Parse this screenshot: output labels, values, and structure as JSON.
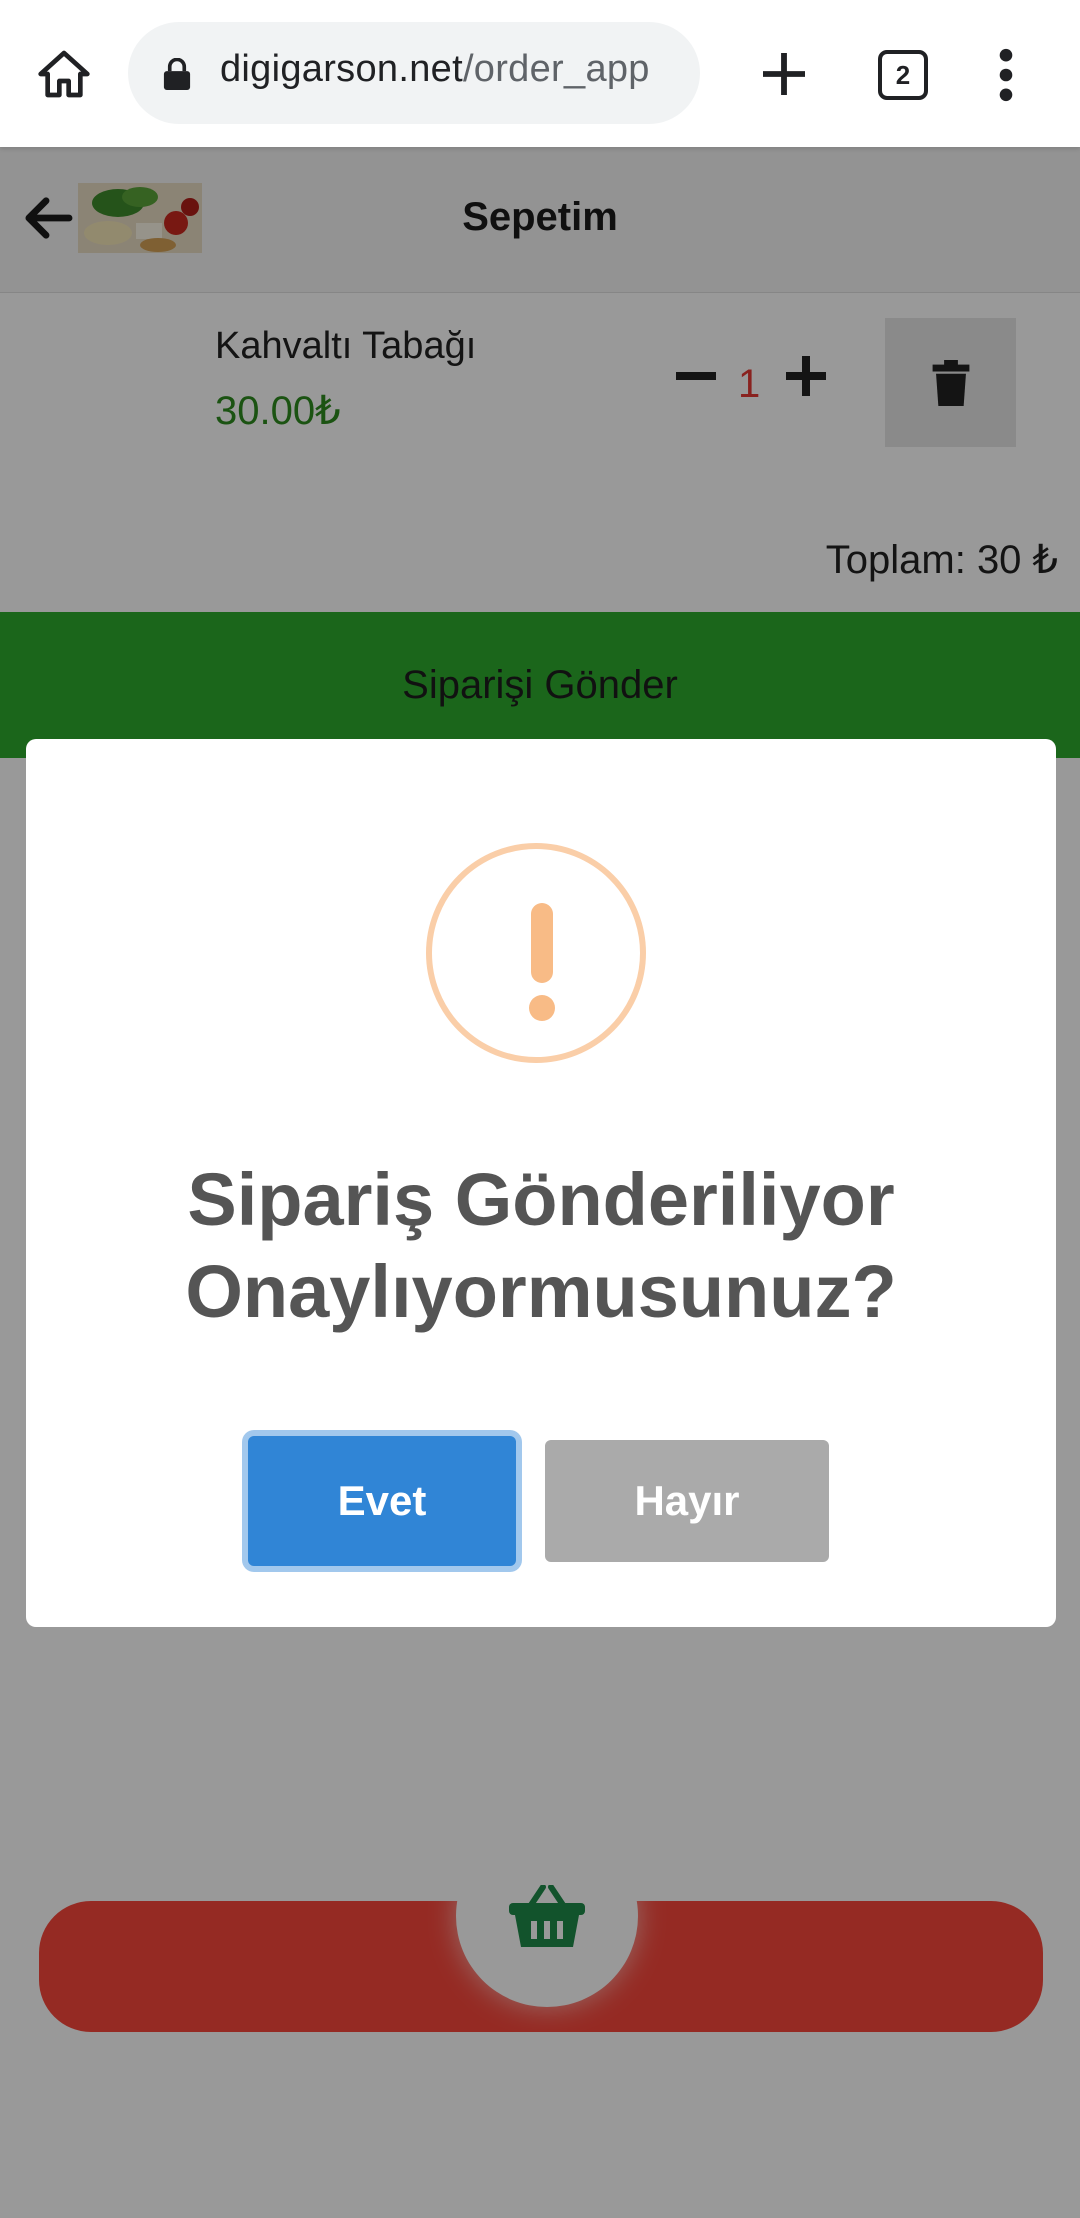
{
  "browser": {
    "url_domain": "digigarson.net",
    "url_path": "/order_app",
    "tab_count": "2"
  },
  "header": {
    "title": "Sepetim"
  },
  "cart": {
    "item_name": "Kahvaltı Tabağı",
    "item_price": "30.00₺",
    "quantity": "1",
    "total": "Toplam: 30 ₺",
    "send_label": "Siparişi Gönder"
  },
  "dialog": {
    "title_line1": "Sipariş Gönderiliyor",
    "title_line2": "Onaylıyormusunuz?",
    "confirm_label": "Evet",
    "cancel_label": "Hayır"
  },
  "icons": {
    "home": "home-icon",
    "user": "user-icon",
    "basket": "basket-icon",
    "search": "search-icon",
    "menu": "menu-icon",
    "trash": "trash-icon",
    "back": "arrow-left-icon",
    "warning": "exclamation-icon"
  },
  "colors": {
    "accent_green": "#2eaa2e",
    "nav_red": "#f9473b",
    "confirm_blue": "#3085d6",
    "cancel_gray": "#aaaaaa",
    "warning_orange": "#f8bb86"
  }
}
